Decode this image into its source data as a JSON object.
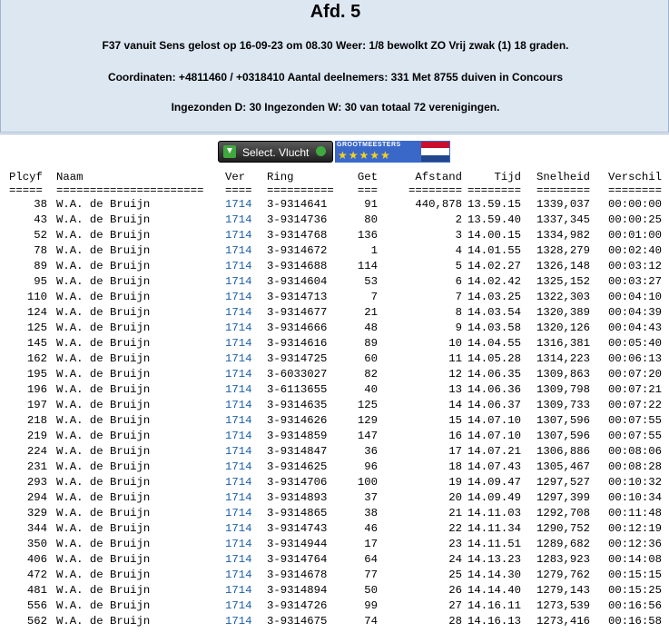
{
  "header": {
    "title": "Afd. 5",
    "line1": "F37 vanuit Sens gelost op 16-09-23 om 08.30 Weer: 1/8 bewolkt ZO Vrij zwak (1) 18 graden.",
    "line2": "Coordinaten: +4811460 / +0318410 Aantal deelnemers: 331 Met 8755 duiven in Concours",
    "line3": "Ingezonden D: 30 Ingezonden W: 30 van totaal 72 verenigingen."
  },
  "toolbar": {
    "select_label": "Select. Vlucht",
    "badge_label": "GROOTMEESTERS",
    "badge_stars": "★★★★★"
  },
  "table": {
    "headers": [
      "Plcyf",
      "Naam",
      "Ver",
      "Ring",
      "Get",
      "Afstand",
      "Tijd",
      "Snelheid",
      "Verschil"
    ],
    "separators": [
      "=====",
      "======================",
      "====",
      "==========",
      "===",
      "========",
      "========",
      "========",
      "========"
    ],
    "rows": [
      [
        "38",
        "W.A. de Bruijn",
        "1714",
        "3-9314641",
        "91",
        "440,878",
        "13.59.15",
        "1339,037",
        "00:00:00"
      ],
      [
        "43",
        "W.A. de Bruijn",
        "1714",
        "3-9314736",
        "80",
        "2",
        "13.59.40",
        "1337,345",
        "00:00:25"
      ],
      [
        "52",
        "W.A. de Bruijn",
        "1714",
        "3-9314768",
        "136",
        "3",
        "14.00.15",
        "1334,982",
        "00:01:00"
      ],
      [
        "78",
        "W.A. de Bruijn",
        "1714",
        "3-9314672",
        "1",
        "4",
        "14.01.55",
        "1328,279",
        "00:02:40"
      ],
      [
        "89",
        "W.A. de Bruijn",
        "1714",
        "3-9314688",
        "114",
        "5",
        "14.02.27",
        "1326,148",
        "00:03:12"
      ],
      [
        "95",
        "W.A. de Bruijn",
        "1714",
        "3-9314604",
        "53",
        "6",
        "14.02.42",
        "1325,152",
        "00:03:27"
      ],
      [
        "110",
        "W.A. de Bruijn",
        "1714",
        "3-9314713",
        "7",
        "7",
        "14.03.25",
        "1322,303",
        "00:04:10"
      ],
      [
        "124",
        "W.A. de Bruijn",
        "1714",
        "3-9314677",
        "21",
        "8",
        "14.03.54",
        "1320,389",
        "00:04:39"
      ],
      [
        "125",
        "W.A. de Bruijn",
        "1714",
        "3-9314666",
        "48",
        "9",
        "14.03.58",
        "1320,126",
        "00:04:43"
      ],
      [
        "145",
        "W.A. de Bruijn",
        "1714",
        "3-9314616",
        "89",
        "10",
        "14.04.55",
        "1316,381",
        "00:05:40"
      ],
      [
        "162",
        "W.A. de Bruijn",
        "1714",
        "3-9314725",
        "60",
        "11",
        "14.05.28",
        "1314,223",
        "00:06:13"
      ],
      [
        "195",
        "W.A. de Bruijn",
        "1714",
        "3-6033027",
        "82",
        "12",
        "14.06.35",
        "1309,863",
        "00:07:20"
      ],
      [
        "196",
        "W.A. de Bruijn",
        "1714",
        "3-6113655",
        "40",
        "13",
        "14.06.36",
        "1309,798",
        "00:07:21"
      ],
      [
        "197",
        "W.A. de Bruijn",
        "1714",
        "3-9314635",
        "125",
        "14",
        "14.06.37",
        "1309,733",
        "00:07:22"
      ],
      [
        "218",
        "W.A. de Bruijn",
        "1714",
        "3-9314626",
        "129",
        "15",
        "14.07.10",
        "1307,596",
        "00:07:55"
      ],
      [
        "219",
        "W.A. de Bruijn",
        "1714",
        "3-9314859",
        "147",
        "16",
        "14.07.10",
        "1307,596",
        "00:07:55"
      ],
      [
        "224",
        "W.A. de Bruijn",
        "1714",
        "3-9314847",
        "36",
        "17",
        "14.07.21",
        "1306,886",
        "00:08:06"
      ],
      [
        "231",
        "W.A. de Bruijn",
        "1714",
        "3-9314625",
        "96",
        "18",
        "14.07.43",
        "1305,467",
        "00:08:28"
      ],
      [
        "293",
        "W.A. de Bruijn",
        "1714",
        "3-9314706",
        "100",
        "19",
        "14.09.47",
        "1297,527",
        "00:10:32"
      ],
      [
        "294",
        "W.A. de Bruijn",
        "1714",
        "3-9314893",
        "37",
        "20",
        "14.09.49",
        "1297,399",
        "00:10:34"
      ],
      [
        "329",
        "W.A. de Bruijn",
        "1714",
        "3-9314865",
        "38",
        "21",
        "14.11.03",
        "1292,708",
        "00:11:48"
      ],
      [
        "344",
        "W.A. de Bruijn",
        "1714",
        "3-9314743",
        "46",
        "22",
        "14.11.34",
        "1290,752",
        "00:12:19"
      ],
      [
        "350",
        "W.A. de Bruijn",
        "1714",
        "3-9314944",
        "17",
        "23",
        "14.11.51",
        "1289,682",
        "00:12:36"
      ],
      [
        "406",
        "W.A. de Bruijn",
        "1714",
        "3-9314764",
        "64",
        "24",
        "14.13.23",
        "1283,923",
        "00:14:08"
      ],
      [
        "472",
        "W.A. de Bruijn",
        "1714",
        "3-9314678",
        "77",
        "25",
        "14.14.30",
        "1279,762",
        "00:15:15"
      ],
      [
        "481",
        "W.A. de Bruijn",
        "1714",
        "3-9314894",
        "50",
        "26",
        "14.14.40",
        "1279,143",
        "00:15:25"
      ],
      [
        "556",
        "W.A. de Bruijn",
        "1714",
        "3-9314726",
        "99",
        "27",
        "14.16.11",
        "1273,539",
        "00:16:56"
      ],
      [
        "562",
        "W.A. de Bruijn",
        "1714",
        "3-9314675",
        "74",
        "28",
        "14.16.13",
        "1273,416",
        "00:16:58"
      ]
    ]
  }
}
